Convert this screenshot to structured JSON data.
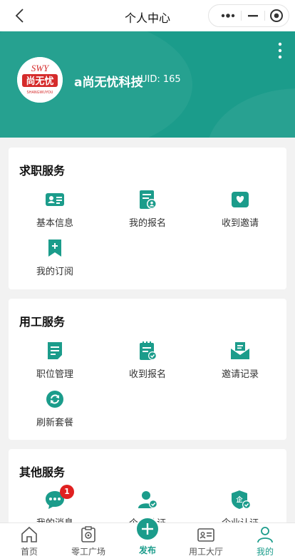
{
  "navbar": {
    "title": "个人中心"
  },
  "user": {
    "name": "a尚无忧科技",
    "uid": "UID: 165",
    "logo_text": "尚无忧",
    "logo_top": "SWY",
    "logo_bottom": "SHANGWUYOU"
  },
  "sections": {
    "job": {
      "title": "求职服务",
      "items": [
        {
          "label": "基本信息",
          "icon": "id-card-icon"
        },
        {
          "label": "我的报名",
          "icon": "application-icon"
        },
        {
          "label": "收到邀请",
          "icon": "invitation-icon"
        },
        {
          "label": "我的订阅",
          "icon": "bookmark-plus-icon"
        }
      ]
    },
    "employer": {
      "title": "用工服务",
      "items": [
        {
          "label": "职位管理",
          "icon": "document-icon"
        },
        {
          "label": "收到报名",
          "icon": "clipboard-check-icon"
        },
        {
          "label": "邀请记录",
          "icon": "mail-tray-icon"
        },
        {
          "label": "刷新套餐",
          "icon": "refresh-icon"
        }
      ]
    },
    "other": {
      "title": "其他服务",
      "items": [
        {
          "label": "我的消息",
          "icon": "chat-icon",
          "badge": "1"
        },
        {
          "label": "个人认证",
          "icon": "person-verified-icon"
        },
        {
          "label": "企业认证",
          "icon": "enterprise-shield-icon"
        }
      ]
    }
  },
  "tabbar": {
    "items": [
      {
        "label": "首页",
        "icon": "home-icon"
      },
      {
        "label": "零工广场",
        "icon": "plaza-icon"
      },
      {
        "label": "发布",
        "icon": "plus-icon"
      },
      {
        "label": "用工大厅",
        "icon": "hall-icon"
      },
      {
        "label": "我的",
        "icon": "user-icon"
      }
    ],
    "active": "我的"
  },
  "colors": {
    "primary": "#1b9c8b",
    "badge": "#e02020",
    "background": "#f2f2f2"
  }
}
